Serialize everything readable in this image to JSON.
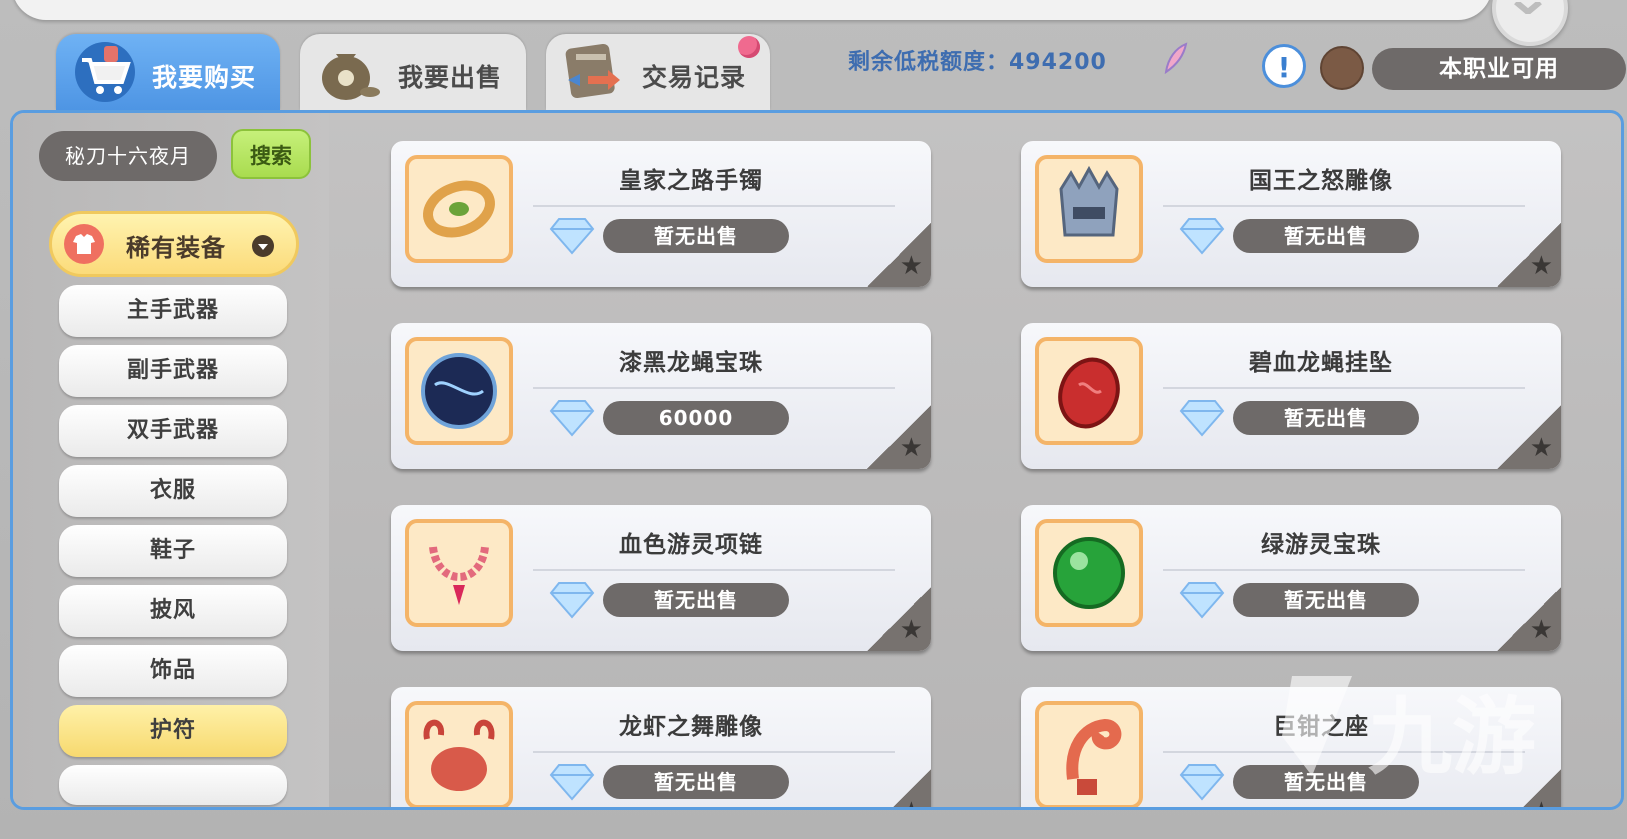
{
  "tabs": [
    {
      "label": "我要购买",
      "icon": "shopping-cart-icon",
      "active": true
    },
    {
      "label": "我要出售",
      "icon": "money-bag-icon",
      "active": false
    },
    {
      "label": "交易记录",
      "icon": "scroll-record-icon",
      "active": false
    }
  ],
  "tax": {
    "text": "剩余低税额度：494200"
  },
  "filters": {
    "job_label": "本职业可用"
  },
  "search": {
    "value": "秘刀十六夜月",
    "button_label": "搜索"
  },
  "category": {
    "label": "稀有装备",
    "icon": "shirt-icon"
  },
  "subcategories": [
    "主手武器",
    "副手武器",
    "双手武器",
    "衣服",
    "鞋子",
    "披风",
    "饰品",
    "护符"
  ],
  "active_subcategory": "护符",
  "items": [
    {
      "name": "皇家之路手镯",
      "price": "暂无出售",
      "icon": "bracelet-icon"
    },
    {
      "name": "国王之怒雕像",
      "price": "暂无出售",
      "icon": "crown-statue-icon"
    },
    {
      "name": "漆黑龙蝇宝珠",
      "price": "60000",
      "icon": "dark-orb-icon"
    },
    {
      "name": "碧血龙蝇挂坠",
      "price": "暂无出售",
      "icon": "red-pendant-icon"
    },
    {
      "name": "血色游灵项链",
      "price": "暂无出售",
      "icon": "necklace-icon"
    },
    {
      "name": "绿游灵宝珠",
      "price": "暂无出售",
      "icon": "green-orb-icon"
    },
    {
      "name": "龙虾之舞雕像",
      "price": "暂无出售",
      "icon": "lobster-statue-icon"
    },
    {
      "name": "巨钳之座",
      "price": "暂无出售",
      "icon": "claw-statue-icon"
    }
  ],
  "colors": {
    "accent_blue": "#4e95e4",
    "price_pill": "#6e6a69",
    "search_green": "#a9dc4f",
    "highlight_yellow": "#fbdb7a"
  },
  "watermark": {
    "text": "九游"
  }
}
